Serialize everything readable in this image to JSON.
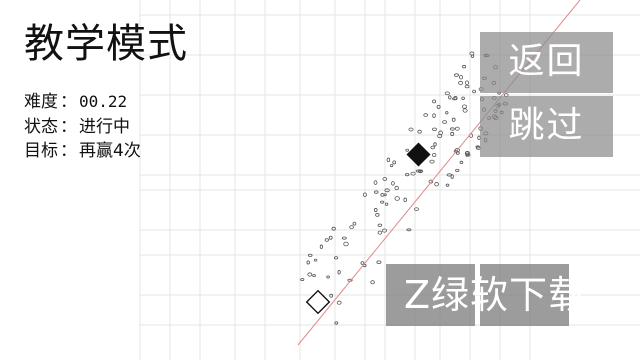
{
  "header": {
    "title": "教学模式"
  },
  "stats": [
    {
      "label": "难度",
      "sep": "：",
      "value": "00.22",
      "mono": true
    },
    {
      "label": "状态",
      "sep": "：",
      "value": "进行中",
      "mono": false
    },
    {
      "label": "目标",
      "sep": "：",
      "value": "再赢4次",
      "mono": false
    }
  ],
  "buttons": {
    "back": "返回",
    "skip": "跳过"
  },
  "watermark": {
    "text": "Z绿软下载"
  },
  "colors": {
    "background": "#ffffff",
    "grid": "#e4e4e4",
    "aim_line": "#e08a8a",
    "enemy": "#111111",
    "particles": "#555555",
    "button_bg": "#8c8c8c",
    "button_text": "#ffffff"
  },
  "player": {
    "shape": "hollow-square"
  },
  "enemy": {
    "shape": "filled-diamond"
  }
}
